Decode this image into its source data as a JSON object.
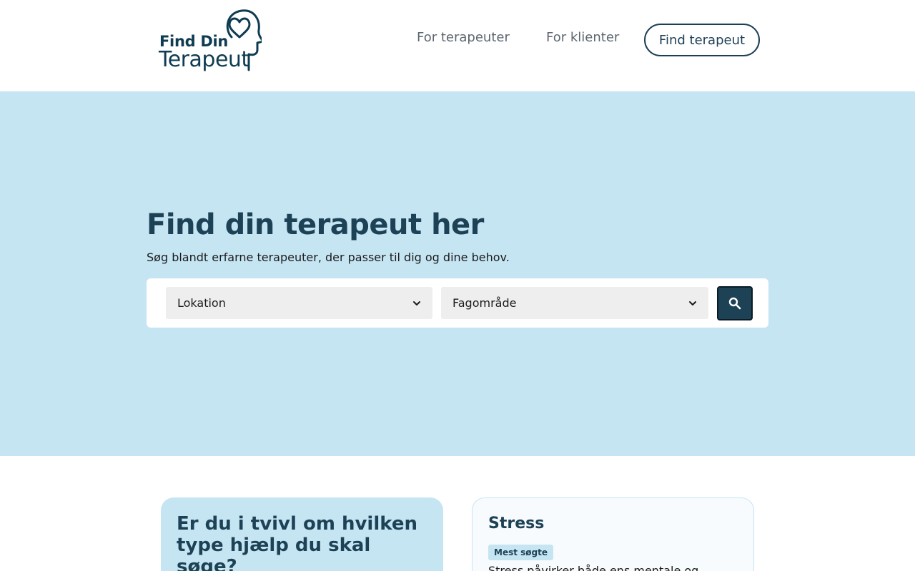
{
  "header": {
    "logo": {
      "line1": "Find Din",
      "line2": "Terapeut",
      "icon": "head-heart-icon",
      "color": "#0f3c52"
    },
    "nav": [
      {
        "label": "For terapeuter"
      },
      {
        "label": "For klienter"
      }
    ],
    "cta_label": "Find terapeut"
  },
  "hero": {
    "background": "#c6e5f3",
    "title": "Find din terapeut her",
    "subtitle": "Søg blandt erfarne terapeuter, der passer til dig og dine behov.",
    "search": {
      "location_select": {
        "selected": "Lokation"
      },
      "field_select": {
        "selected": "Fagområde"
      },
      "button_icon": "search-icon",
      "button_color": "#1d4256"
    }
  },
  "cards": {
    "left": {
      "title": "Er du i tvivl om hvilken type hjælp du skal søge?"
    },
    "right": {
      "title": "Stress",
      "badge": "Mest søgte",
      "text": "Stress påvirker både ens mentale og"
    }
  }
}
